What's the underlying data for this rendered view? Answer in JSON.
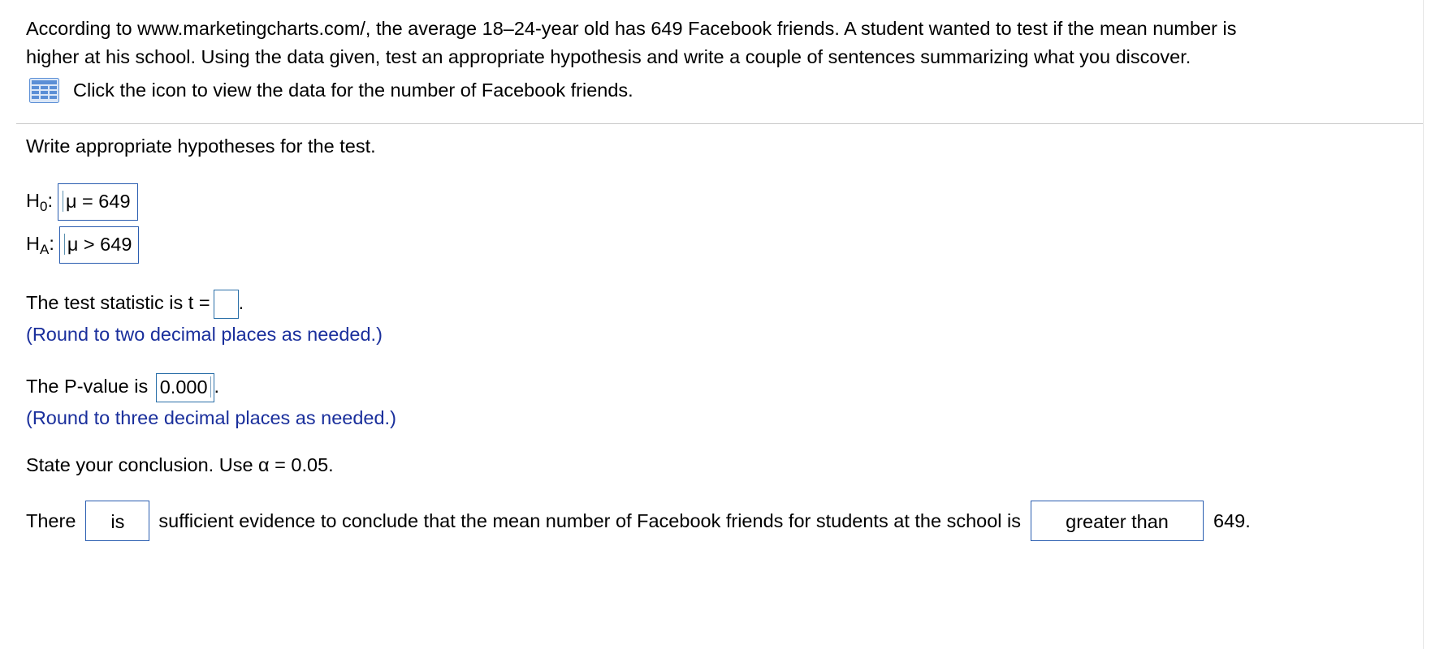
{
  "question": {
    "intro_line1": "According to www.marketingcharts.com/, the average 18–24-year old has 649 Facebook friends. A student wanted to test if the mean number is",
    "intro_line2": "higher at his school. Using the data given, test an appropriate hypothesis and write a couple of sentences summarizing what you discover.",
    "data_link_text": "Click the icon to view the data for the number of Facebook friends.",
    "data_icon": "table-grid-icon"
  },
  "hypotheses": {
    "prompt": "Write appropriate hypotheses for the test.",
    "h0_label": "H",
    "h0_sub": "0",
    "h0_value": "μ = 649",
    "ha_label": "H",
    "ha_sub": "A",
    "ha_value": "μ > 649",
    "colon": ":"
  },
  "test_statistic": {
    "label": "The test statistic is t =",
    "value": "",
    "period": ".",
    "hint": "(Round to two decimal places as needed.)"
  },
  "p_value": {
    "label": "The P-value is",
    "value": "0.000",
    "period": ".",
    "hint": "(Round to three decimal places as needed.)"
  },
  "conclusion": {
    "prompt": "State your conclusion. Use α = 0.05.",
    "prefix": "There",
    "select1_value": "is",
    "middle": "sufficient evidence to conclude that the mean number of Facebook friends for students at the school is",
    "select2_value": "greater than",
    "suffix": "649."
  },
  "colors": {
    "hint_text": "#1a2f9c",
    "answer_border": "#2a5db0",
    "divider": "#c9c9c9",
    "icon_blue": "#5b8fd6"
  }
}
